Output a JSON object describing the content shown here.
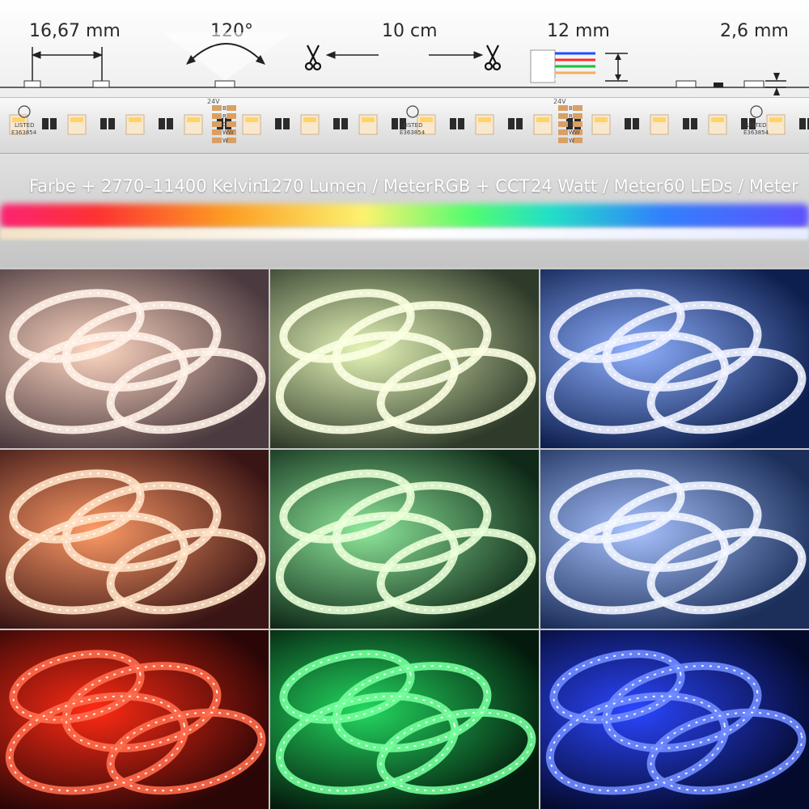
{
  "dimensions": {
    "width_label": "16,67 mm",
    "angle_label": "120°",
    "cut_label": "10 cm",
    "wire_label": "12 mm",
    "height_label": "2,6 mm"
  },
  "strip_markings": {
    "ul_text": "LISTED",
    "cert": "E363854",
    "voltage": "24V",
    "pins": [
      "B",
      "R",
      "G",
      "WW",
      "W"
    ]
  },
  "specs": [
    "Farbe + 2770–11400 Kelvin",
    "1270 Lumen / Meter",
    "RGB + CCT",
    "24 Watt / Meter",
    "60 LEDs / Meter"
  ],
  "gallery": {
    "rows": 3,
    "cols": 3,
    "tiles": [
      {
        "bg": "#4b3a3f",
        "glow": "#ffd7c2",
        "strip": "#fff1e6"
      },
      {
        "bg": "#2f3b2a",
        "glow": "#e6f6b8",
        "strip": "#fbffe0"
      },
      {
        "bg": "#0d1f4e",
        "glow": "#8fb0ff",
        "strip": "#eef2ff"
      },
      {
        "bg": "#3a1515",
        "glow": "#ff9a66",
        "strip": "#ffe1c4"
      },
      {
        "bg": "#0f2a18",
        "glow": "#8ee79a",
        "strip": "#e9ffd6"
      },
      {
        "bg": "#1b2f5a",
        "glow": "#a9c3ff",
        "strip": "#f1f5ff"
      },
      {
        "bg": "#2a0606",
        "glow": "#ff2a14",
        "strip": "#ff6a4a"
      },
      {
        "bg": "#041a0c",
        "glow": "#23d860",
        "strip": "#72ff9a"
      },
      {
        "bg": "#040a2c",
        "glow": "#2b45ff",
        "strip": "#6f8bff"
      }
    ]
  }
}
